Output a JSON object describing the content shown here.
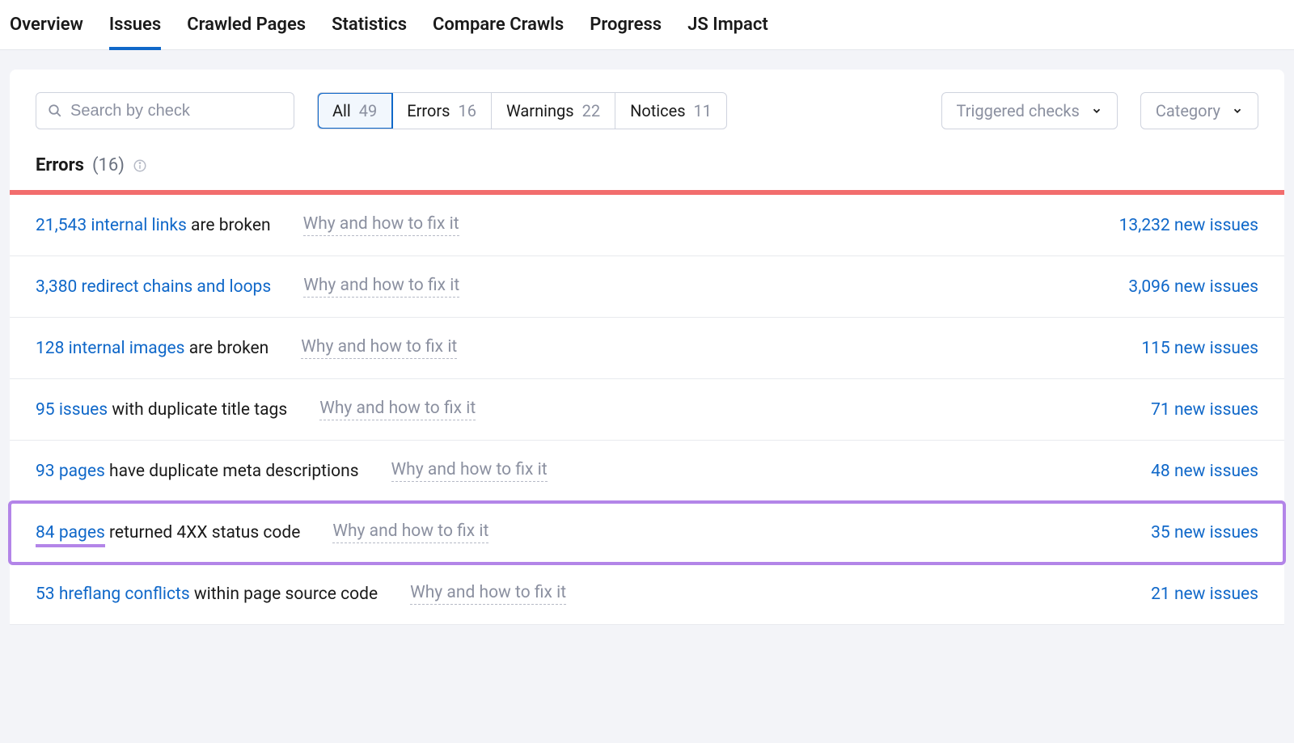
{
  "tabs": [
    "Overview",
    "Issues",
    "Crawled Pages",
    "Statistics",
    "Compare Crawls",
    "Progress",
    "JS Impact"
  ],
  "active_tab": 1,
  "search": {
    "placeholder": "Search by check"
  },
  "filters": {
    "segments": [
      {
        "label": "All",
        "count": "49",
        "active": true
      },
      {
        "label": "Errors",
        "count": "16",
        "active": false
      },
      {
        "label": "Warnings",
        "count": "22",
        "active": false
      },
      {
        "label": "Notices",
        "count": "11",
        "active": false
      }
    ],
    "triggered_label": "Triggered checks",
    "category_label": "Category"
  },
  "section": {
    "title": "Errors",
    "count_paren": "(16)"
  },
  "fix_label": "Why and how to fix it",
  "issues": [
    {
      "link": "21,543 internal links",
      "rest": " are broken",
      "new": "13,232 new issues",
      "highlight": false
    },
    {
      "link": "3,380 redirect chains and loops",
      "rest": "",
      "new": "3,096 new issues",
      "highlight": false
    },
    {
      "link": "128 internal images",
      "rest": " are broken",
      "new": "115 new issues",
      "highlight": false
    },
    {
      "link": "95 issues",
      "rest": " with duplicate title tags",
      "new": "71 new issues",
      "highlight": false
    },
    {
      "link": "93 pages",
      "rest": " have duplicate meta descriptions",
      "new": "48 new issues",
      "highlight": false
    },
    {
      "link": "84 pages",
      "rest": " returned 4XX status code",
      "new": "35 new issues",
      "highlight": true
    },
    {
      "link": "53 hreflang conflicts",
      "rest": " within page source code",
      "new": "21 new issues",
      "highlight": false
    }
  ]
}
